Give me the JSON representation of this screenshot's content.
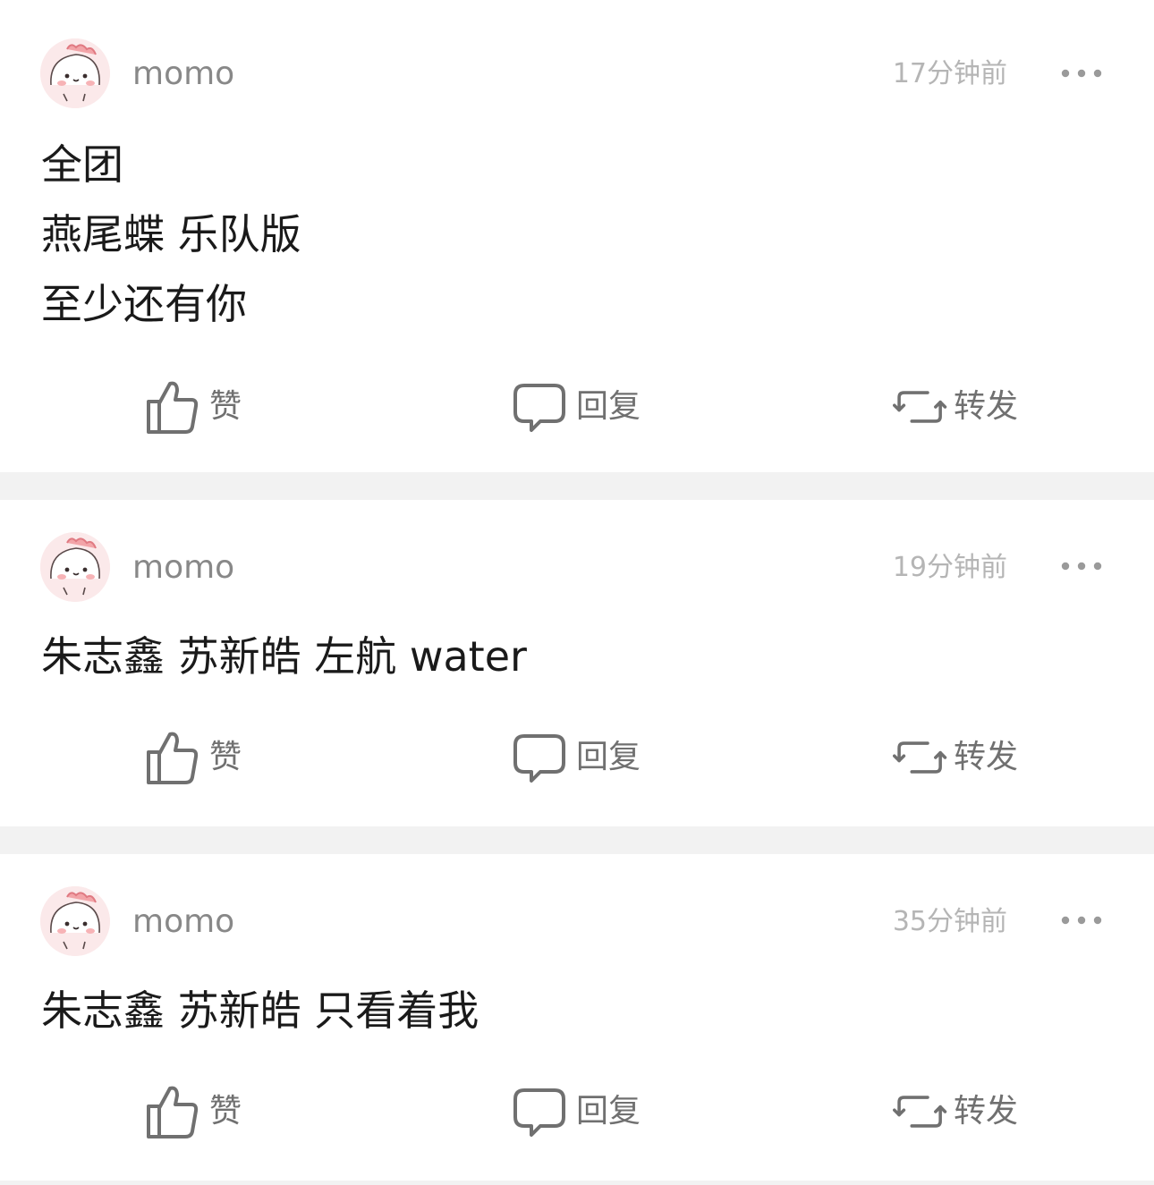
{
  "posts": [
    {
      "username": "momo",
      "time": "17分钟前",
      "lines": [
        "全团",
        "燕尾蝶 乐队版",
        "至少还有你"
      ],
      "actions": {
        "like": "赞",
        "reply": "回复",
        "repost": "转发"
      }
    },
    {
      "username": "momo",
      "time": "19分钟前",
      "lines": [
        "朱志鑫 苏新皓 左航 water"
      ],
      "actions": {
        "like": "赞",
        "reply": "回复",
        "repost": "转发"
      }
    },
    {
      "username": "momo",
      "time": "35分钟前",
      "lines": [
        "朱志鑫 苏新皓 只看着我"
      ],
      "actions": {
        "like": "赞",
        "reply": "回复",
        "repost": "转发"
      }
    }
  ],
  "icons": {
    "like": "thumbs-up-icon",
    "reply": "comment-bubble-icon",
    "repost": "repost-icon",
    "more": "more-dots-icon"
  },
  "colors": {
    "icon_gray": "#707070",
    "time_gray": "#b5b5b5",
    "username_gray": "#888888",
    "avatar_pink": "#fbe9ea"
  }
}
